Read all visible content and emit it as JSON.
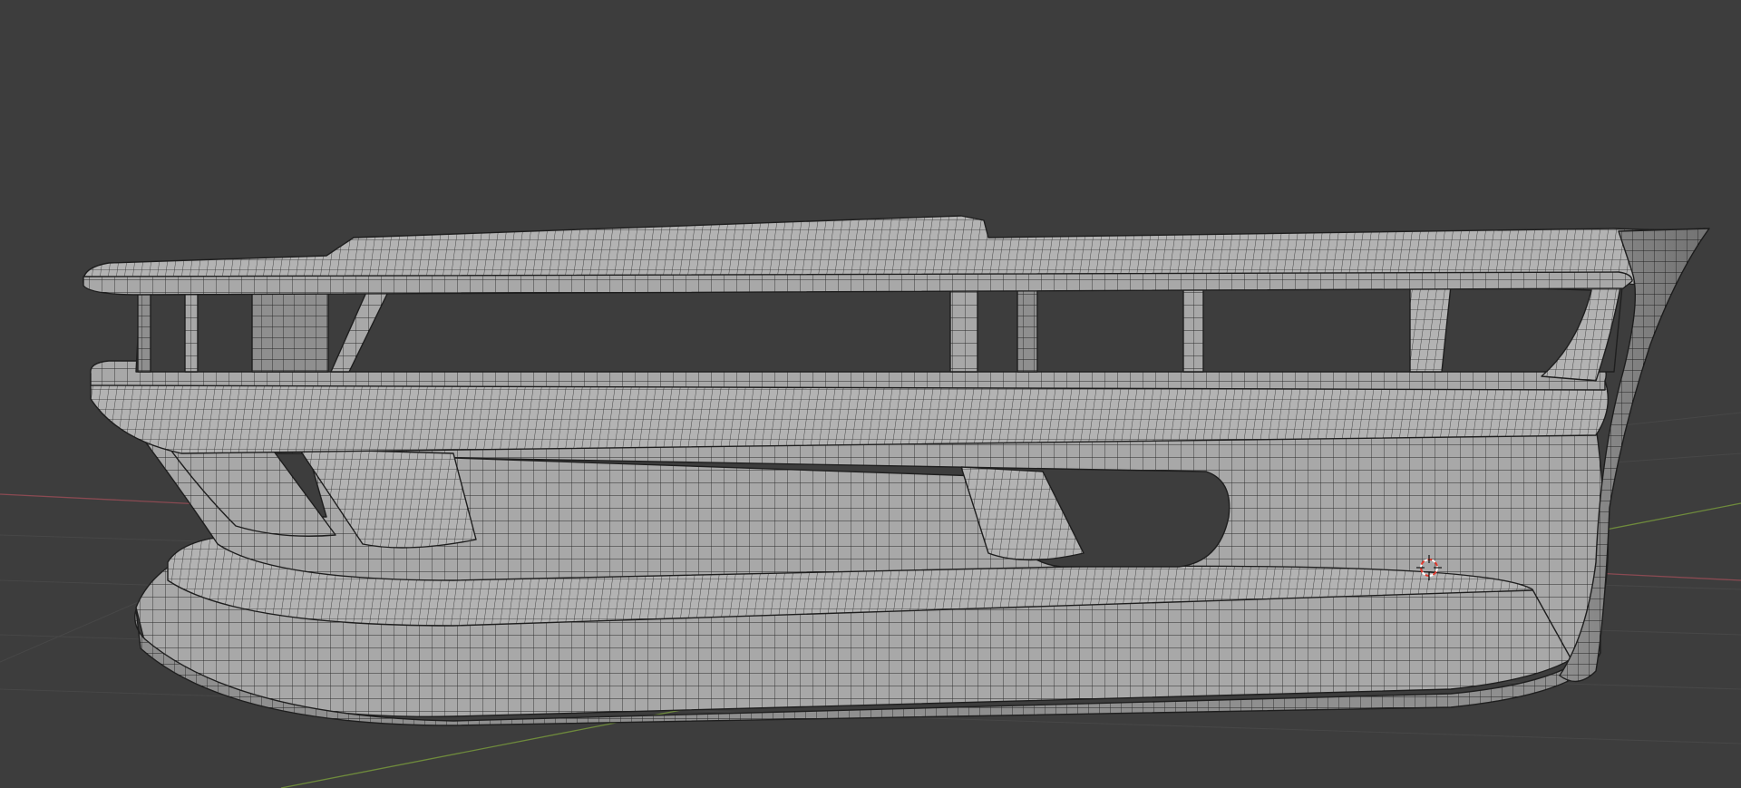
{
  "viewport": {
    "mode": "3D Viewport",
    "shading": "solid",
    "overlay": "wireframe",
    "background_color": "#3d3d3d",
    "grid_color": "#474747",
    "axis_x_color": "#8a4a52",
    "axis_y_color": "#6e8a3c"
  },
  "object": {
    "icon": "mesh-object-icon",
    "description_color_surface": "#a9a9a9",
    "wire_color": "#1e1e1e"
  },
  "cursor": {
    "icon": "3d-cursor-icon",
    "color_a": "#e23a2e",
    "color_b": "#ffffff"
  }
}
